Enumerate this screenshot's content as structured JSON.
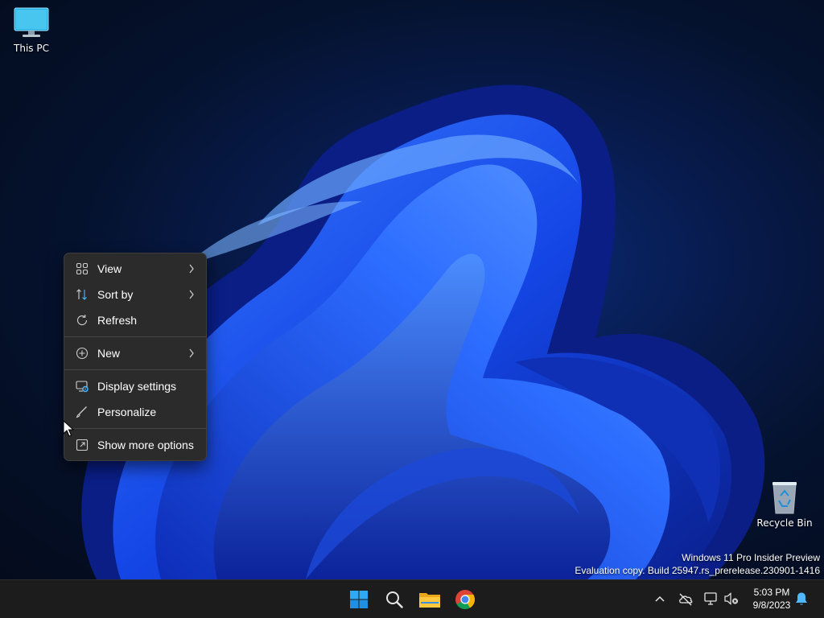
{
  "desktop": {
    "icons": [
      {
        "label": "This PC"
      },
      {
        "label": "Recycle Bin"
      }
    ],
    "watermark": {
      "line1": "Windows 11 Pro Insider Preview",
      "line2": "Evaluation copy. Build 25947.rs_prerelease.230901-1416"
    }
  },
  "context_menu": {
    "items": [
      {
        "label": "View",
        "icon": "grid-icon",
        "submenu": true
      },
      {
        "label": "Sort by",
        "icon": "sort-icon",
        "submenu": true
      },
      {
        "label": "Refresh",
        "icon": "refresh-icon",
        "submenu": false
      },
      {
        "label": "New",
        "icon": "plus-circle-icon",
        "submenu": true
      },
      {
        "label": "Display settings",
        "icon": "display-settings-icon",
        "submenu": false
      },
      {
        "label": "Personalize",
        "icon": "brush-icon",
        "submenu": false
      },
      {
        "label": "Show more options",
        "icon": "show-more-icon",
        "submenu": false
      }
    ]
  },
  "taskbar": {
    "apps": [
      {
        "icon": "windows-start-icon"
      },
      {
        "icon": "search-icon"
      },
      {
        "icon": "file-explorer-icon"
      },
      {
        "icon": "chrome-icon"
      }
    ],
    "tray": [
      "chevron-up-icon",
      "onedrive-offline-icon",
      "network-icon",
      "volume-muted-icon",
      "notification-bell-icon"
    ],
    "clock": {
      "time": "5:03 PM",
      "date": "9/8/2023"
    }
  },
  "colors": {
    "accent": "#0078d4",
    "menu_bg": "#2b2b2b",
    "taskbar_bg": "#1c1c1c"
  }
}
